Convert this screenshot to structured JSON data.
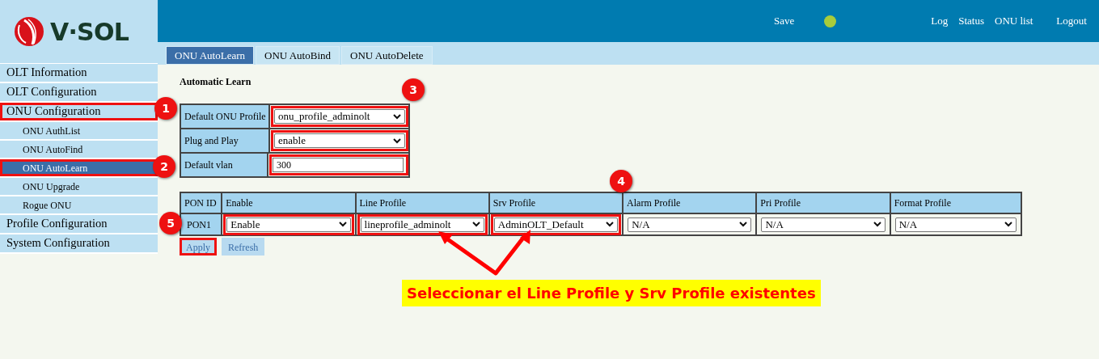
{
  "brand": {
    "name": "V·SOL"
  },
  "header": {
    "save": "Save",
    "status_dot": {
      "color": "#a8cc3c"
    },
    "links": [
      "Log",
      "Status",
      "ONU list"
    ],
    "logout": "Logout"
  },
  "sidebar": {
    "items": [
      {
        "label": "OLT Information",
        "selected": false,
        "highlighted": false
      },
      {
        "label": "OLT Configuration",
        "selected": false,
        "highlighted": false
      },
      {
        "label": "ONU Configuration",
        "selected": false,
        "highlighted": true,
        "children": [
          {
            "label": "ONU AuthList",
            "selected": false,
            "highlighted": false
          },
          {
            "label": "ONU AutoFind",
            "selected": false,
            "highlighted": false
          },
          {
            "label": "ONU AutoLearn",
            "selected": true,
            "highlighted": true
          },
          {
            "label": "ONU Upgrade",
            "selected": false,
            "highlighted": false
          },
          {
            "label": "Rogue ONU",
            "selected": false,
            "highlighted": false
          }
        ]
      },
      {
        "label": "Profile Configuration",
        "selected": false,
        "highlighted": false
      },
      {
        "label": "System Configuration",
        "selected": false,
        "highlighted": false
      }
    ]
  },
  "tabs": [
    {
      "label": "ONU AutoLearn",
      "selected": true
    },
    {
      "label": "ONU AutoBind",
      "selected": false
    },
    {
      "label": "ONU AutoDelete",
      "selected": false
    }
  ],
  "section_title": "Automatic Learn",
  "form": [
    {
      "label": "Default ONU Profile",
      "kind": "select",
      "value": "onu_profile_adminolt",
      "highlighted": true
    },
    {
      "label": "Plug and Play",
      "kind": "select",
      "value": "enable",
      "highlighted": true
    },
    {
      "label": "Default vlan",
      "kind": "input",
      "value": "300",
      "highlighted": true
    }
  ],
  "table": {
    "columns": [
      "PON ID",
      "Enable",
      "Line Profile",
      "Srv Profile",
      "Alarm Profile",
      "Pri Profile",
      "Format Profile"
    ],
    "rows": [
      {
        "cells": [
          {
            "kind": "text",
            "value": "PON1",
            "highlighted": false
          },
          {
            "value": "Enable",
            "highlighted": true
          },
          {
            "value": "lineprofile_adminolt",
            "highlighted": true
          },
          {
            "value": "AdminOLT_Default",
            "highlighted": true
          },
          {
            "value": "N/A",
            "highlighted": false
          },
          {
            "value": "N/A",
            "highlighted": false
          },
          {
            "value": "N/A",
            "highlighted": false
          }
        ]
      }
    ]
  },
  "buttons": [
    {
      "label": "Apply",
      "highlighted": true
    },
    {
      "label": "Refresh",
      "highlighted": false
    }
  ],
  "annotations": {
    "badges": [
      "1",
      "2",
      "3",
      "4",
      "5"
    ],
    "caption": "Seleccionar el Line Profile y Srv Profile existentes"
  }
}
